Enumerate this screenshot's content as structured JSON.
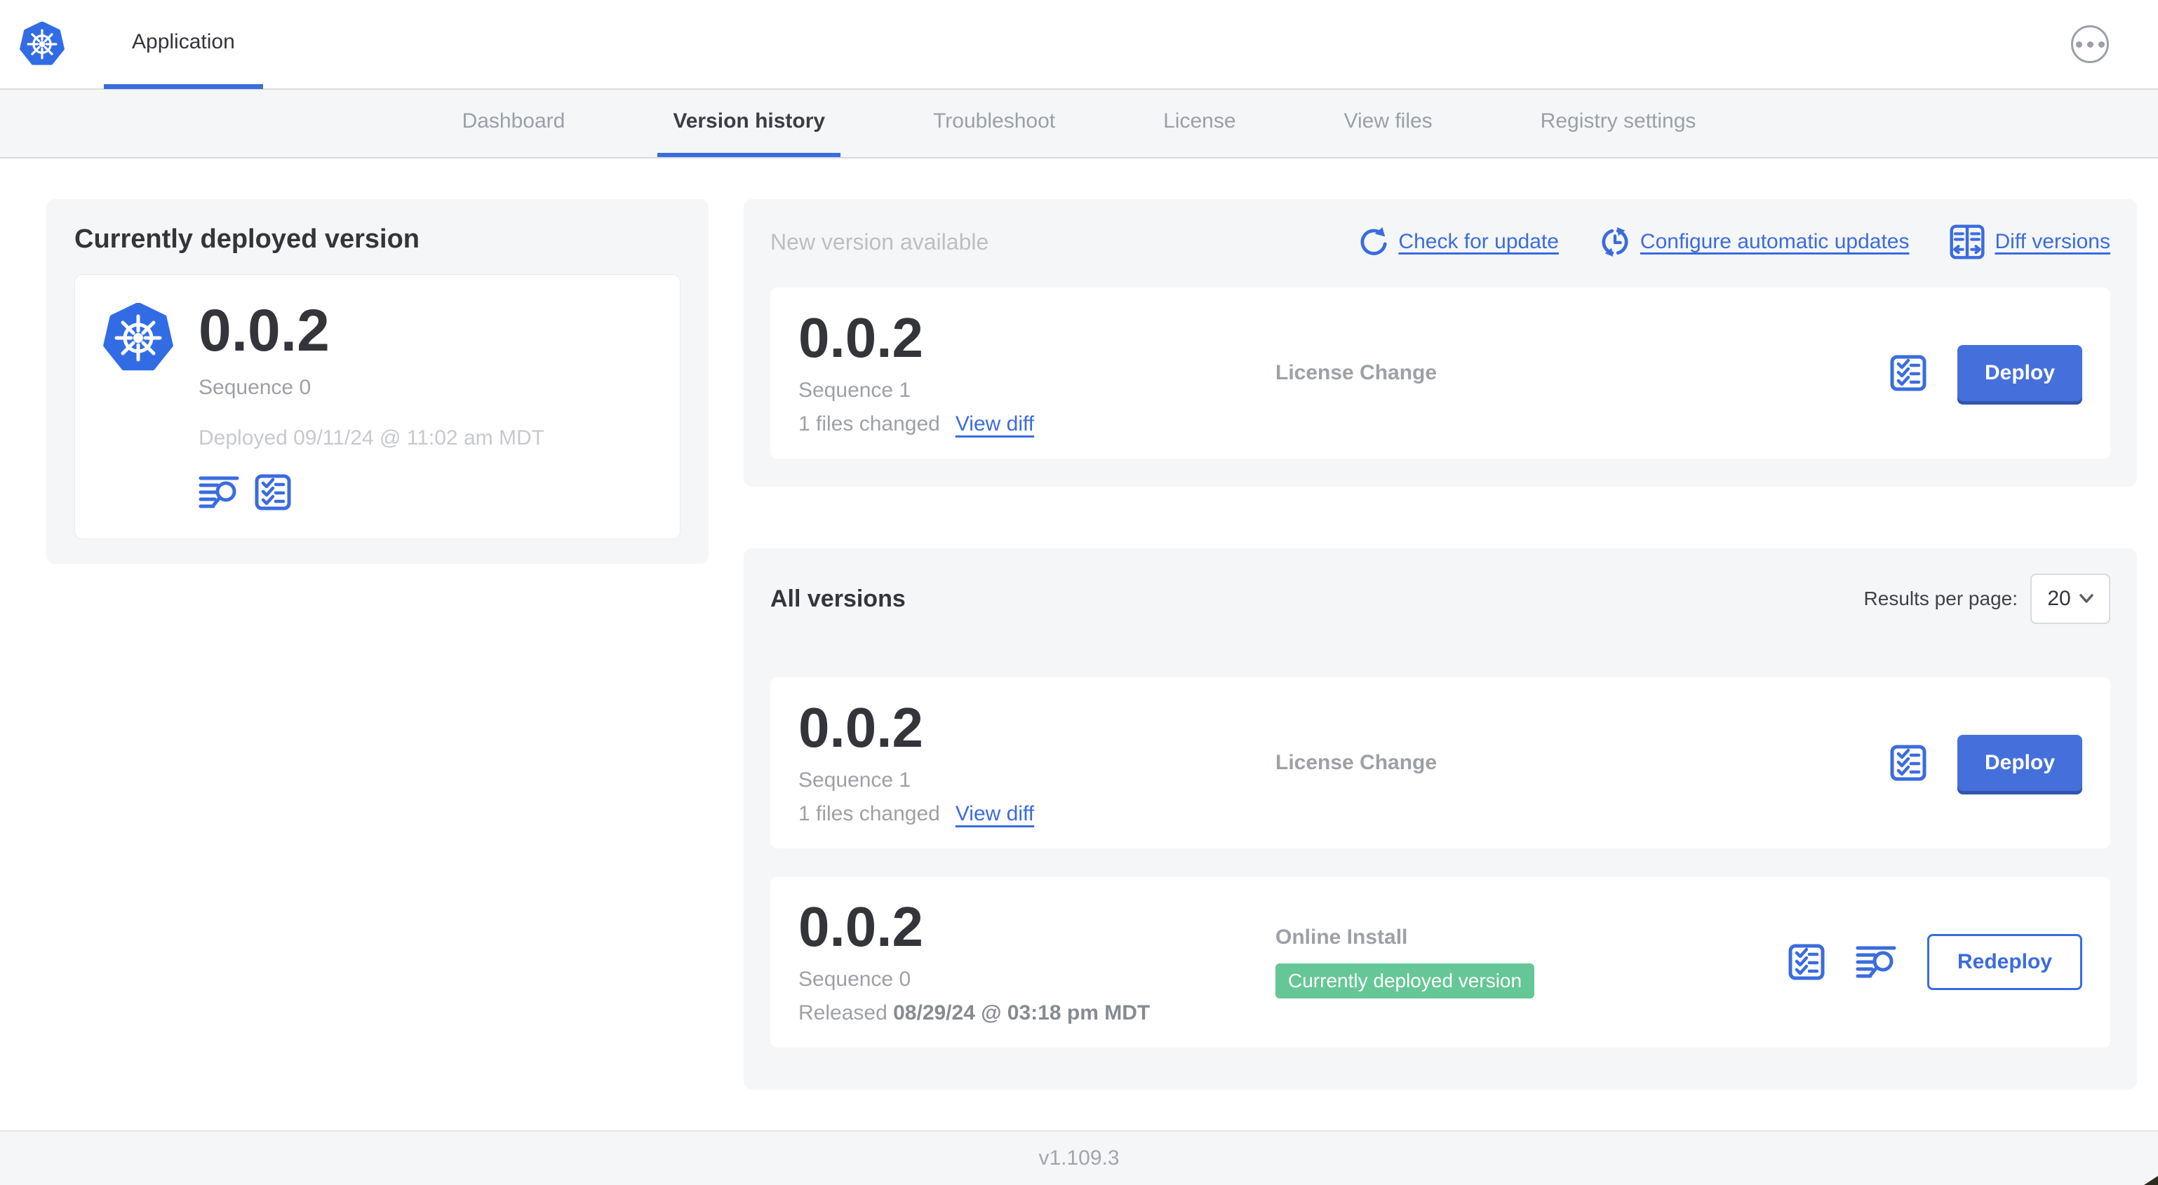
{
  "app": {
    "title": "Application"
  },
  "nav": {
    "tabs": [
      "Dashboard",
      "Version history",
      "Troubleshoot",
      "License",
      "View files",
      "Registry settings"
    ],
    "active": "Version history"
  },
  "current": {
    "heading": "Currently deployed version",
    "version": "0.0.2",
    "sequence": "Sequence 0",
    "deployed": "Deployed 09/11/24 @ 11:02 am MDT"
  },
  "new_version": {
    "heading": "New version available",
    "check_for_update": "Check for update",
    "configure_auto_updates": "Configure automatic updates",
    "diff_versions": "Diff versions",
    "version": "0.0.2",
    "sequence": "Sequence 1",
    "files_changed": "1 files changed",
    "view_diff": "View diff",
    "source": "License Change",
    "action": "Deploy"
  },
  "all_versions": {
    "heading": "All versions",
    "results_per_page_label": "Results per page:",
    "results_per_page": "20",
    "rows": [
      {
        "version": "0.0.2",
        "sequence": "Sequence 1",
        "files_changed": "1 files changed",
        "view_diff": "View diff",
        "source": "License Change",
        "action": "Deploy"
      },
      {
        "version": "0.0.2",
        "sequence": "Sequence 0",
        "released_label": "Released",
        "released_date": "08/29/24 @ 03:18 pm MDT",
        "source": "Online Install",
        "badge": "Currently deployed version",
        "action": "Redeploy"
      }
    ]
  },
  "footer": {
    "version": "v1.109.3"
  },
  "colors": {
    "accent": "#3b6cde",
    "button_blue": "#4570dc",
    "badge_green": "#65c795",
    "logo_blue": "#326ce5",
    "panel_gray": "#f5f6f8"
  }
}
